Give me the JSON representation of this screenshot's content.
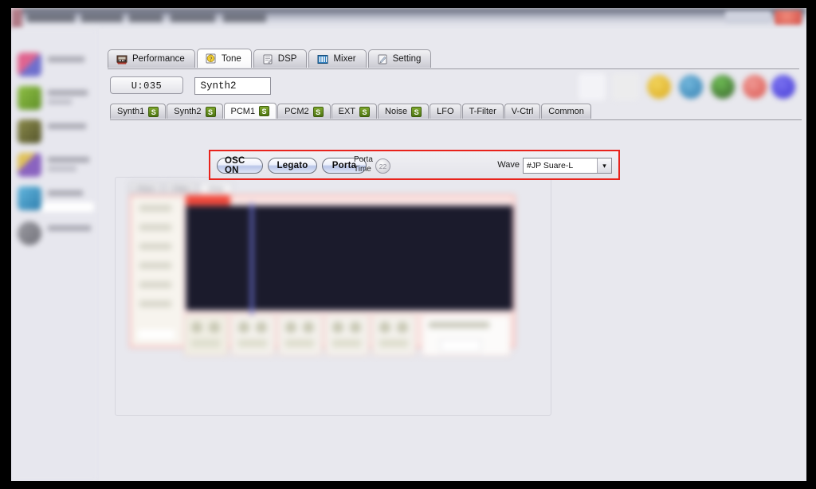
{
  "window": {
    "title_blurred": true,
    "close_button_label": "x",
    "colors": {
      "frame": "#000000",
      "app_background": "#e6e6ec",
      "accent_red": "#e8231c",
      "badge_green": "#4d7412",
      "graph_dark": "#1b1b2c",
      "cursor_blue": "#6f74d8"
    }
  },
  "sidebar": {
    "blurred": true,
    "items": [
      {
        "name": "sidebar-item-1",
        "icon": "app-icon-pink",
        "icon_color": "#d9608f"
      },
      {
        "name": "sidebar-item-2",
        "icon": "app-icon-green",
        "icon_color": "#7bad3a"
      },
      {
        "name": "sidebar-item-3",
        "icon": "app-icon-olive",
        "icon_color": "#6f7043"
      },
      {
        "name": "sidebar-item-4",
        "icon": "app-icon-purple",
        "icon_color": "#8a63c0"
      },
      {
        "name": "sidebar-item-5",
        "icon": "app-icon-blue",
        "icon_color": "#3e9ccc",
        "selected": true
      },
      {
        "name": "sidebar-item-6",
        "icon": "app-icon-gray",
        "icon_color": "#8b8b92"
      }
    ]
  },
  "toolbar": {
    "blurred": true,
    "icons": [
      {
        "name": "document-icon",
        "color": "#f3f3f7"
      },
      {
        "name": "page-icon",
        "color": "#eeeef2"
      },
      {
        "name": "folder-icon",
        "color": "#e0b52c"
      },
      {
        "name": "save-icon",
        "color": "#4e93c4"
      },
      {
        "name": "tree-icon",
        "color": "#4f8f3f"
      },
      {
        "name": "record-icon",
        "color": "#e06a6a"
      },
      {
        "name": "globe-icon",
        "color": "#5b52e0"
      }
    ]
  },
  "main_tabs": [
    {
      "label": "Performance",
      "icon": "performance-icon",
      "active": false
    },
    {
      "label": "Tone",
      "icon": "tone-icon",
      "active": true
    },
    {
      "label": "DSP",
      "icon": "dsp-icon",
      "active": false
    },
    {
      "label": "Mixer",
      "icon": "mixer-icon",
      "active": false
    },
    {
      "label": "Setting",
      "icon": "setting-icon",
      "active": false
    }
  ],
  "patch": {
    "number": "U:035",
    "name_value": "Synth2",
    "name_placeholder": ""
  },
  "sub_tabs": [
    {
      "label": "Synth1",
      "badge": "S",
      "active": false
    },
    {
      "label": "Synth2",
      "badge": "S",
      "active": false
    },
    {
      "label": "PCM1",
      "badge": "S",
      "active": true
    },
    {
      "label": "PCM2",
      "badge": "S",
      "active": false
    },
    {
      "label": "EXT",
      "badge": "S",
      "active": false
    },
    {
      "label": "Noise",
      "badge": "S",
      "active": false
    },
    {
      "label": "LFO",
      "badge": "",
      "active": false
    },
    {
      "label": "T-Filter",
      "badge": "",
      "active": false
    },
    {
      "label": "V-Ctrl",
      "badge": "",
      "active": false
    },
    {
      "label": "Common",
      "badge": "",
      "active": false
    }
  ],
  "osc_row": {
    "highlighted": true,
    "buttons": [
      {
        "label": "OSC ON",
        "name": "osc-on-button"
      },
      {
        "label": "Legato",
        "name": "legato-button"
      },
      {
        "label": "Porta",
        "name": "porta-button"
      }
    ],
    "porta_time": {
      "label_line1": "Porta",
      "label_line2": "Time",
      "value": "22"
    },
    "wave": {
      "label": "Wave",
      "value": "#JP Suare-L",
      "arrow": "▾"
    }
  },
  "envelope_editor": {
    "blurred": true,
    "sub_tabs": [
      {
        "label": "Pitch",
        "active": false
      },
      {
        "label": "Filter",
        "active": false
      },
      {
        "label": "Amp",
        "active": true
      }
    ],
    "cell_count": 5,
    "has_graph": true
  }
}
